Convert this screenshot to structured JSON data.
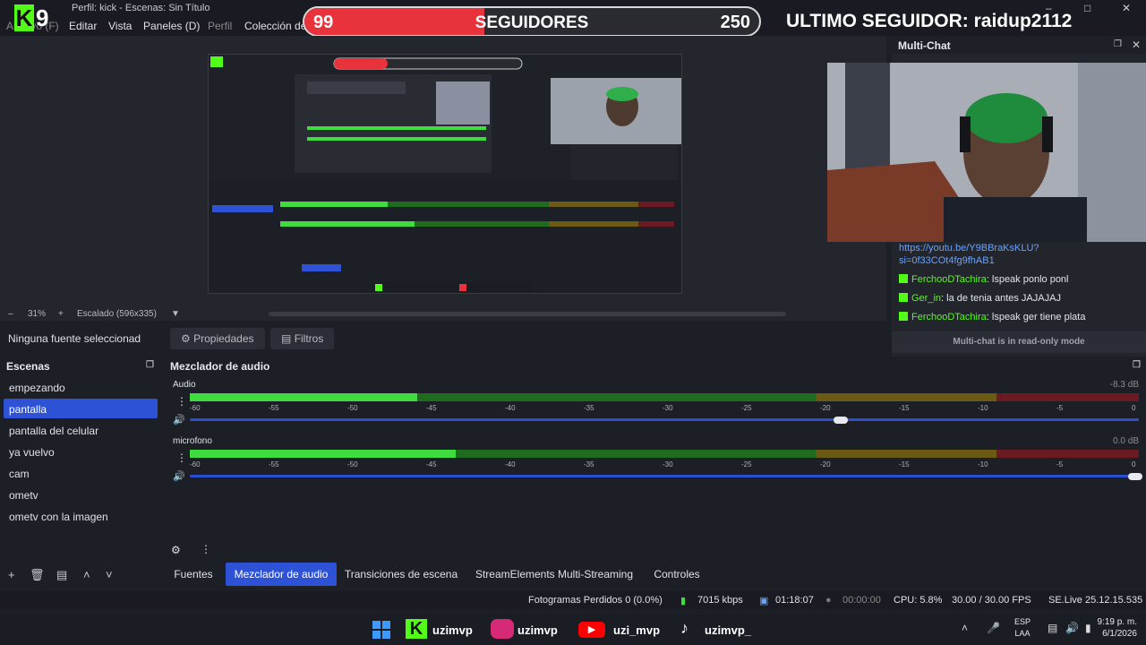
{
  "window": {
    "title_text": "Perfil: kick - Escenas: Sin Título",
    "menu": [
      "Archivo (F)",
      "Editar",
      "Vista",
      "Paneles (D)",
      "Perfil",
      "Colección de escenas"
    ]
  },
  "overlay": {
    "brand": {
      "letter": "K",
      "number": "9"
    },
    "followers": {
      "current": "99",
      "label": "SEGUIDORES",
      "goal": "250",
      "progress": 0.396
    },
    "last_follower": "ULTIMO SEGUIDOR: raidup2112"
  },
  "preview_bar": {
    "zoom": "31%",
    "scaled": "Escalado (596x335)"
  },
  "source_bar": {
    "no_source": "Ninguna fuente seleccionad",
    "properties": "Propiedades",
    "filters": "Filtros"
  },
  "multichat": {
    "title": "Multi-Chat",
    "link": "https://youtu.be/Y9BBraKsKLU?si=0f33COt4fg9fhAB1",
    "messages": [
      {
        "user": "FerchooDTachira",
        "text": ": lspeak ponlo ponl"
      },
      {
        "user": "Ger_in",
        "text": ": la de tenia antes JAJAJAJ"
      },
      {
        "user": "FerchooDTachira",
        "text": ": lspeak ger tiene plata"
      }
    ],
    "readonly": "Multi-chat is in read-only mode"
  },
  "scenes": {
    "title": "Escenas",
    "items": [
      "empezando",
      "pantalla",
      "pantalla del celular",
      "ya vuelvo",
      "cam",
      "ometv",
      "ometv con la imagen"
    ],
    "active_index": 1
  },
  "mixer": {
    "title": "Mezclador de audio",
    "scale": [
      "-60",
      "-55",
      "-50",
      "-45",
      "-40",
      "-35",
      "-30",
      "-25",
      "-20",
      "-15",
      "-10",
      "-5",
      "0"
    ],
    "channels": [
      {
        "name": "Audio",
        "db": "-8.3 dB",
        "level": 0.24,
        "volume": 0.69
      },
      {
        "name": "microfono",
        "db": "0.0 dB",
        "level": 0.28,
        "volume": 1.0
      }
    ]
  },
  "tabs": {
    "items": [
      "Fuentes",
      "Mezclador de audio",
      "Transiciones de escena",
      "StreamElements Multi-Streaming",
      "Controles"
    ],
    "active_index": 1
  },
  "status": {
    "dropped": "Fotogramas Perdidos 0 (0.0%)",
    "bitrate": "7015 kbps",
    "live_time": "01:18:07",
    "rec_time": "00:00:00",
    "cpu": "CPU: 5.8%",
    "fps": "30.00 / 30.00 FPS",
    "version": "SE.Live 25.12.15.535"
  },
  "taskbar": {
    "handles": [
      "uzimvp",
      "uzimvp",
      "uzi_mvp",
      "uzimvp_"
    ],
    "lang": [
      "ESP",
      "LAA"
    ],
    "time": "9:19 p. m.",
    "date": "6/1/2026"
  },
  "colors": {
    "accent": "#2e52d6",
    "kick_green": "#53fc18",
    "follow_red": "#e8323c"
  }
}
